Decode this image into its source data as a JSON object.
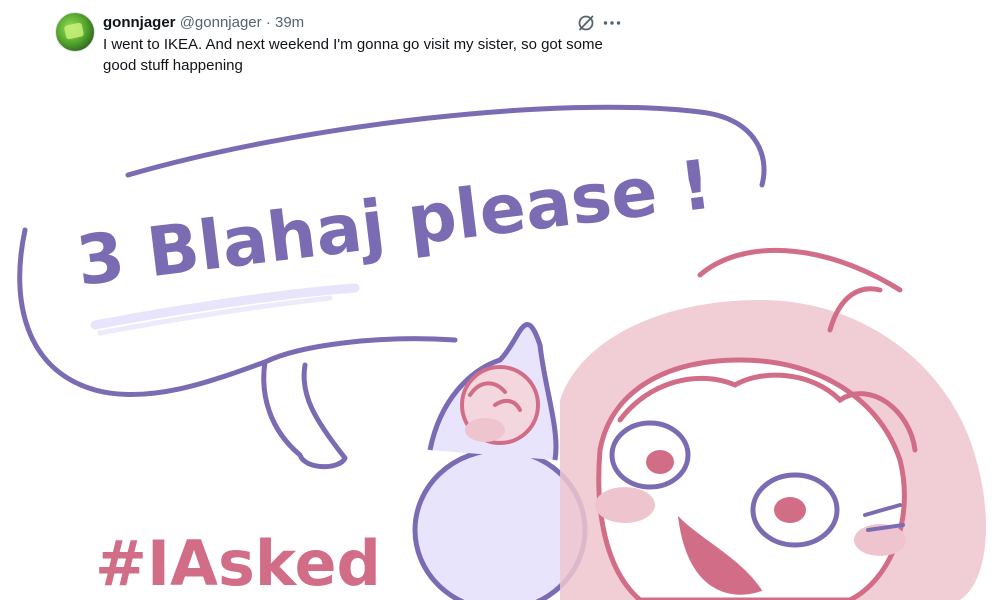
{
  "tweet": {
    "display_name": "gonnjager",
    "handle": "@gonnjager",
    "separator": "·",
    "time": "39m",
    "text_line1": "I went to IKEA. And next weekend I'm gonna go visit my sister, so got some",
    "text_line2": "good stuff happening"
  },
  "icons": {
    "grok": "grok-icon",
    "more": "more-dots-icon"
  },
  "image": {
    "speech_line1": "3 Blahaj please !",
    "hashtag": "#IAsked"
  },
  "colors": {
    "purple": "#7b6bb3",
    "purple_fill": "#e7e4fb",
    "pink": "#d26d88",
    "pink_fill": "#eec5cf",
    "text": "#0f1419",
    "muted": "#536471"
  }
}
